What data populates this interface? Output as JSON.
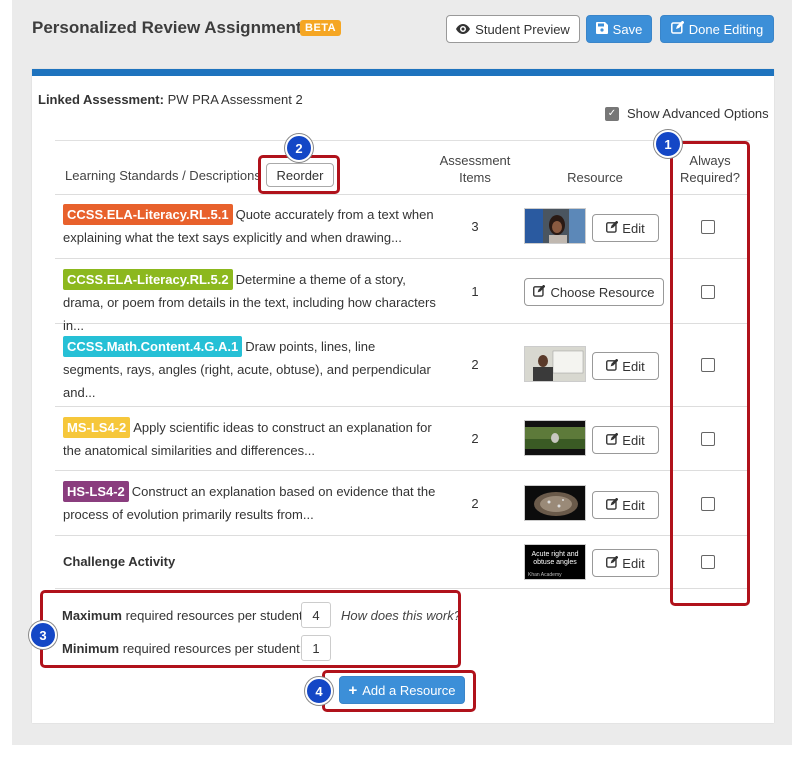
{
  "header": {
    "title": "Personalized Review Assignment",
    "beta": "BETA",
    "preview_label": "Student Preview",
    "save_label": "Save",
    "done_label": "Done Editing"
  },
  "linked": {
    "label": "Linked Assessment:",
    "value": "PW PRA Assessment 2"
  },
  "advanced_options": {
    "label": "Show Advanced Options",
    "checked": true
  },
  "table": {
    "col_standards": "Learning Standards / Descriptions",
    "reorder_label": "Reorder",
    "col_items_1": "Assessment",
    "col_items_2": "Items",
    "col_resource": "Resource",
    "col_required_1": "Always",
    "col_required_2": "Required?",
    "rows": [
      {
        "code": "CCSS.ELA-Literacy.RL.5.1",
        "color": "#e8612c",
        "desc": "Quote accurately from a text when explaining what the text says explicitly and when drawing...",
        "items": "3",
        "resource": "Edit"
      },
      {
        "code": "CCSS.ELA-Literacy.RL.5.2",
        "color": "#8cb81e",
        "desc": "Determine a theme of a story, drama, or poem from details in the text, including how characters in...",
        "items": "1",
        "resource": "Choose Resource"
      },
      {
        "code": "CCSS.Math.Content.4.G.A.1",
        "color": "#26c0d6",
        "desc": "Draw points, lines, line segments, rays, angles (right, acute, obtuse), and perpendicular and...",
        "items": "2",
        "resource": "Edit"
      },
      {
        "code": "MS-LS4-2",
        "color": "#f6c73b",
        "desc": "Apply scientific ideas to construct an explanation for the anatomical similarities and differences...",
        "items": "2",
        "resource": "Edit"
      },
      {
        "code": "HS-LS4-2",
        "color": "#8a3d7e",
        "desc": "Construct an explanation based on evidence that the process of evolution primarily results from...",
        "items": "2",
        "resource": "Edit"
      },
      {
        "code": "",
        "color": "",
        "desc": "Challenge Activity",
        "items": "",
        "resource": "Edit"
      }
    ]
  },
  "thumb_text": {
    "line1": "Acute right and",
    "line2": "obtuse angles",
    "line3": "Khan Academy"
  },
  "limits": {
    "max_bold": "Maximum",
    "max_rest": "required resources per student:",
    "max_value": "4",
    "min_bold": "Minimum",
    "min_rest": "required resources per student:",
    "min_value": "1",
    "how": "How does this work?"
  },
  "add_label": "Add a Resource",
  "callouts": [
    "1",
    "2",
    "3",
    "4"
  ],
  "colors": {
    "primary": "#3c8fd8",
    "card_top": "#1e73be",
    "callout_red": "#b0121b",
    "callout_blue": "#1447c6"
  }
}
